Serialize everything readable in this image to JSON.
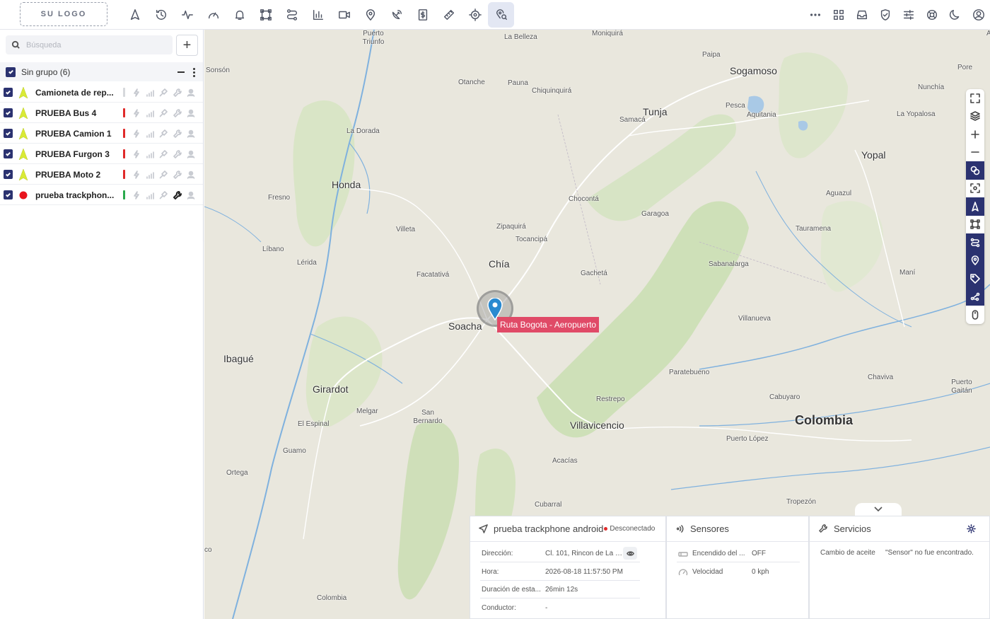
{
  "header": {
    "logo_text": "SU LOGO",
    "nav_icons": [
      "navigation-arrow-icon",
      "history-icon",
      "activity-pulse-icon",
      "gauge-icon",
      "bell-icon",
      "geofence-square-icon",
      "route-icon",
      "bar-chart-icon",
      "video-camera-icon",
      "map-pin-icon",
      "satellite-dish-icon",
      "dollar-document-icon",
      "ruler-icon",
      "crosshair-icon",
      "search-location-icon"
    ],
    "active_nav": "search-location-icon",
    "right_icons": [
      "more-dots-icon",
      "grid-apps-icon",
      "inbox-icon",
      "shield-icon",
      "sliders-icon",
      "lifebuoy-icon",
      "moon-icon",
      "user-account-icon"
    ]
  },
  "sidebar": {
    "search_placeholder": "Búsqueda",
    "add_label": "+",
    "group": {
      "label": "Sin grupo (6)",
      "checked": true
    },
    "devices": [
      {
        "name": "Camioneta de rep...",
        "icon": "arrow",
        "status_color": "#d6d8dc",
        "checked": true,
        "wrench_active": false
      },
      {
        "name": "PRUEBA Bus 4",
        "icon": "arrow",
        "status_color": "#e02a2a",
        "checked": true,
        "wrench_active": false
      },
      {
        "name": "PRUEBA Camion 1",
        "icon": "arrow",
        "status_color": "#e02a2a",
        "checked": true,
        "wrench_active": false
      },
      {
        "name": "PRUEBA Furgon 3",
        "icon": "arrow",
        "status_color": "#e02a2a",
        "checked": true,
        "wrench_active": false
      },
      {
        "name": "PRUEBA Moto 2",
        "icon": "arrow",
        "status_color": "#e02a2a",
        "checked": true,
        "wrench_active": false
      },
      {
        "name": "prueba trackphon...",
        "icon": "dot",
        "status_color": "#2aa94c",
        "checked": true,
        "wrench_active": true
      }
    ]
  },
  "map": {
    "places": [
      {
        "label": "Puerto Triunfo",
        "cls": ""
      },
      {
        "label": "La Belleza",
        "cls": ""
      },
      {
        "label": "Moniquirá",
        "cls": ""
      },
      {
        "label": "Paipa",
        "cls": ""
      },
      {
        "label": "Sogamoso",
        "cls": "big"
      },
      {
        "label": "Pore",
        "cls": ""
      },
      {
        "label": "Arjon",
        "cls": ""
      },
      {
        "label": "Sonsón",
        "cls": ""
      },
      {
        "label": "Otanche",
        "cls": ""
      },
      {
        "label": "Pauna",
        "cls": ""
      },
      {
        "label": "Chiquinquirá",
        "cls": ""
      },
      {
        "label": "Pesca",
        "cls": ""
      },
      {
        "label": "Aquitania",
        "cls": ""
      },
      {
        "label": "Nunchía",
        "cls": ""
      },
      {
        "label": "La Yopalosa",
        "cls": ""
      },
      {
        "label": "Tunja",
        "cls": "big"
      },
      {
        "label": "Samacá",
        "cls": ""
      },
      {
        "label": "La Dorada",
        "cls": ""
      },
      {
        "label": "Yopal",
        "cls": "big"
      },
      {
        "label": "Honda",
        "cls": "big"
      },
      {
        "label": "Aguazul",
        "cls": ""
      },
      {
        "label": "Fresno",
        "cls": ""
      },
      {
        "label": "Chocontá",
        "cls": ""
      },
      {
        "label": "Garagoa",
        "cls": ""
      },
      {
        "label": "Villeta",
        "cls": ""
      },
      {
        "label": "Zipaquirá",
        "cls": ""
      },
      {
        "label": "Tauramena",
        "cls": ""
      },
      {
        "label": "Tocancipá",
        "cls": ""
      },
      {
        "label": "Líbano",
        "cls": ""
      },
      {
        "label": "Lérida",
        "cls": ""
      },
      {
        "label": "Chía",
        "cls": "big"
      },
      {
        "label": "Sabanalarga",
        "cls": ""
      },
      {
        "label": "Facatativá",
        "cls": ""
      },
      {
        "label": "Gachetá",
        "cls": ""
      },
      {
        "label": "Maní",
        "cls": ""
      },
      {
        "label": "Villanueva",
        "cls": ""
      },
      {
        "label": "Soacha",
        "cls": "big"
      },
      {
        "label": "Ibagué",
        "cls": "big"
      },
      {
        "label": "Paratebueno",
        "cls": ""
      },
      {
        "label": "Chaviva",
        "cls": ""
      },
      {
        "label": "Girardot",
        "cls": "big"
      },
      {
        "label": "Cabuyaro",
        "cls": ""
      },
      {
        "label": "Puerto Gaitán",
        "cls": ""
      },
      {
        "label": "Restrepo",
        "cls": ""
      },
      {
        "label": "Melgar",
        "cls": ""
      },
      {
        "label": "San Bernardo",
        "cls": ""
      },
      {
        "label": "El Espinal",
        "cls": ""
      },
      {
        "label": "Villavicencio",
        "cls": "big"
      },
      {
        "label": "Colombia",
        "cls": "huge"
      },
      {
        "label": "Puerto López",
        "cls": ""
      },
      {
        "label": "Guamo",
        "cls": ""
      },
      {
        "label": "Acacías",
        "cls": ""
      },
      {
        "label": "Ortega",
        "cls": ""
      },
      {
        "label": "Cubarral",
        "cls": ""
      },
      {
        "label": "Tropezón",
        "cls": ""
      },
      {
        "label": "Colombia",
        "cls": ""
      },
      {
        "label": "co",
        "cls": ""
      }
    ],
    "route_label": "Ruta Bogota - Aeropuerto",
    "tools": [
      {
        "icon": "fullscreen-icon",
        "on": false
      },
      {
        "icon": "layers-icon",
        "on": false
      },
      {
        "icon": "zoom-in-icon",
        "on": false
      },
      {
        "icon": "zoom-out-icon",
        "on": false
      },
      {
        "icon": "link-icon",
        "on": true
      },
      {
        "icon": "focus-icon",
        "on": false
      },
      {
        "icon": "navigation-arrow-icon",
        "on": true
      },
      {
        "icon": "geofence-square-icon",
        "on": false
      },
      {
        "icon": "route-icon",
        "on": true
      },
      {
        "icon": "map-pin-icon",
        "on": true
      },
      {
        "icon": "tag-icon",
        "on": true
      },
      {
        "icon": "share-nodes-icon",
        "on": true
      },
      {
        "icon": "mouse-icon",
        "on": false
      }
    ]
  },
  "device_panel": {
    "title": "prueba trackphone android",
    "status": "Desconectado",
    "status_color": "#e02a2a",
    "rows": [
      {
        "key": "Dirección:",
        "value": "Cl. 101, Rincon de La P..."
      },
      {
        "key": "Hora:",
        "value": "2026-08-18 11:57:50 PM"
      },
      {
        "key": "Duración de esta...",
        "value": "26min 12s"
      },
      {
        "key": "Conductor:",
        "value": "-"
      }
    ]
  },
  "sensors_panel": {
    "title": "Sensores",
    "rows": [
      {
        "key": "Encendido del ...",
        "value": "OFF"
      },
      {
        "key": "Velocidad",
        "value": "0 kph"
      }
    ]
  },
  "services_panel": {
    "title": "Servicios",
    "key": "Cambio de aceite",
    "value": "\"Sensor\" no fue encontrado."
  }
}
